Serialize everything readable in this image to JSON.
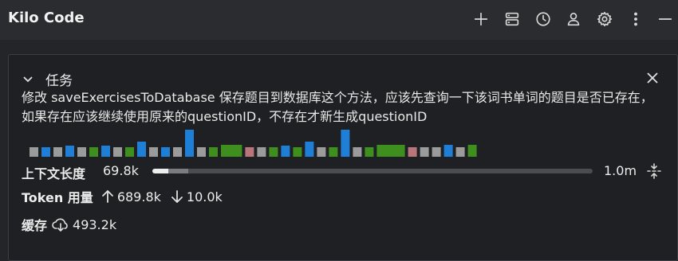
{
  "app": {
    "title": "Kilo Code"
  },
  "toolbar": {
    "icons": [
      "plus-icon",
      "database-icon",
      "history-icon",
      "account-icon",
      "gear-icon",
      "more-vertical-icon",
      "minimize-icon"
    ]
  },
  "task": {
    "label": "任务",
    "text": "修改 saveExercisesToDatabase 保存题目到数据库这个方法，应该先查询一下该词书单词的题目是否已存在，如果存在应该继续使用原来的questionID，不存在才新生成questionID"
  },
  "histogram": {
    "colors": {
      "gray": "#9b9b9b",
      "blue": "#1f7fd6",
      "green": "#3f8f1e",
      "red": "#b9767a"
    },
    "bars": [
      {
        "c": "gray",
        "h": 0.35
      },
      {
        "c": "blue",
        "h": 0.35
      },
      {
        "c": "gray",
        "h": 0.35
      },
      {
        "c": "blue",
        "h": 0.4
      },
      {
        "c": "gray",
        "h": 0.35
      },
      {
        "c": "green",
        "h": 0.35
      },
      {
        "c": "blue",
        "h": 0.4
      },
      {
        "c": "gray",
        "h": 0.35
      },
      {
        "c": "green",
        "h": 0.35
      },
      {
        "c": "blue",
        "h": 0.55
      },
      {
        "c": "gray",
        "h": 0.35
      },
      {
        "c": "blue",
        "h": 0.35
      },
      {
        "c": "gray",
        "h": 0.35
      },
      {
        "c": "blue",
        "h": 1.0
      },
      {
        "c": "gray",
        "h": 0.35
      },
      {
        "c": "green",
        "h": 0.35
      },
      {
        "c": "green",
        "w": 2.4,
        "h": 0.45
      },
      {
        "c": "red",
        "h": 0.35
      },
      {
        "c": "gray",
        "h": 0.35
      },
      {
        "c": "green",
        "h": 0.35
      },
      {
        "c": "blue",
        "h": 0.4
      },
      {
        "c": "green",
        "h": 0.35
      },
      {
        "c": "blue",
        "h": 0.55
      },
      {
        "c": "gray",
        "h": 0.35
      },
      {
        "c": "green",
        "h": 0.35
      },
      {
        "c": "blue",
        "h": 1.0
      },
      {
        "c": "gray",
        "h": 0.35
      },
      {
        "c": "green",
        "h": 0.35
      },
      {
        "c": "green",
        "w": 3.2,
        "h": 0.45
      },
      {
        "c": "red",
        "h": 0.35
      },
      {
        "c": "gray",
        "h": 0.35
      },
      {
        "c": "gray",
        "h": 0.35
      },
      {
        "c": "blue",
        "h": 0.45
      },
      {
        "c": "gray",
        "h": 0.35
      },
      {
        "c": "green",
        "h": 0.45
      }
    ]
  },
  "context": {
    "label": "上下文长度",
    "value": "69.8k",
    "max": "1.0m",
    "used_fraction": 0.0698,
    "cached_fraction": 0.063
  },
  "tokens": {
    "label": "Token 用量",
    "up": "689.8k",
    "down": "10.0k"
  },
  "cache": {
    "label": "缓存",
    "value": "493.2k"
  }
}
